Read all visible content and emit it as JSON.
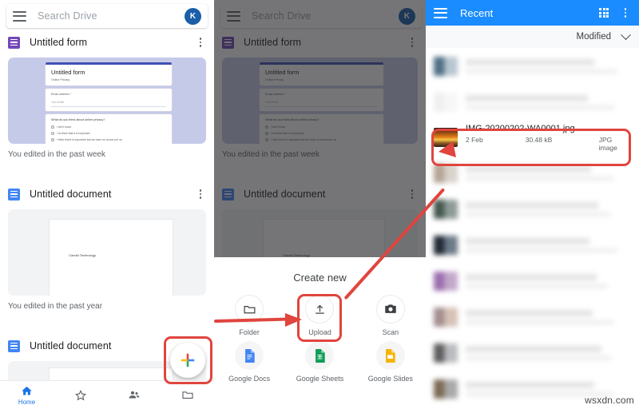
{
  "app": {
    "search": {
      "placeholder": "Search Drive",
      "avatar_initial": "K"
    }
  },
  "left_panel": {
    "cards": [
      {
        "icon": "google-forms-icon",
        "title": "Untitled form",
        "edited": "You edited in the past week",
        "preview": {
          "form_title": "Untitled form",
          "form_subtitle": "Online Privacy",
          "email_label": "Email address *",
          "email_placeholder": "Your email",
          "question": "What do you think about online privacy?",
          "options": [
            "I don't know",
            "I do think that it is important",
            "I think that it is important but we have no choice per se"
          ]
        }
      },
      {
        "icon": "google-docs-icon",
        "title": "Untitled document",
        "edited": "You edited in the past year",
        "preview": {
          "doc_text": "Candid Technology"
        }
      },
      {
        "icon": "google-docs-icon",
        "title": "Untitled document",
        "edited": "",
        "preview": {
          "doc_text": ""
        }
      }
    ],
    "bottom_nav": [
      {
        "icon": "home-icon",
        "label": "Home",
        "active": true
      },
      {
        "icon": "star-icon",
        "label": "",
        "active": false
      },
      {
        "icon": "shared-icon",
        "label": "",
        "active": false
      },
      {
        "icon": "folder-icon",
        "label": "",
        "active": false
      }
    ],
    "fab": {
      "icon": "plus-icon",
      "label": ""
    }
  },
  "create_sheet": {
    "title": "Create new",
    "items": [
      {
        "icon": "folder-icon",
        "label": "Folder"
      },
      {
        "icon": "upload-icon",
        "label": "Upload"
      },
      {
        "icon": "scan-camera-icon",
        "label": "Scan"
      },
      {
        "icon": "google-docs-icon",
        "label": "Google Docs"
      },
      {
        "icon": "google-sheets-icon",
        "label": "Google Sheets"
      },
      {
        "icon": "google-slides-icon",
        "label": "Google Slides"
      }
    ]
  },
  "right_panel": {
    "appbar": {
      "title": "Recent",
      "menu_icon": "hamburger-icon",
      "grid_icon": "grid-view-icon",
      "overflow_icon": "more-vert-icon"
    },
    "sort": {
      "label": "Modified",
      "icon": "chevron-down-icon"
    },
    "selected_file": {
      "name": "IMG-20200202-WA0001.jpg",
      "date": "2 Feb",
      "size": "30.48 kB",
      "type": "JPG image"
    },
    "redacted_row_count": 11
  },
  "annotations": {
    "highlight_color": "#e0453e",
    "boxes": [
      "fab-highlight",
      "upload-highlight",
      "selected-file-highlight"
    ],
    "arrows": [
      "fab-to-upload",
      "upload-to-selected-file"
    ]
  },
  "watermark": "wsxdn.com",
  "colors": {
    "appbar_blue": "#1a8cff",
    "accent_blue": "#1a73e8",
    "forms_purple": "#7248b9",
    "docs_blue": "#4285f4",
    "sheets_green": "#0f9d58",
    "slides_yellow": "#f4b400",
    "red_annotation": "#e0453e"
  }
}
